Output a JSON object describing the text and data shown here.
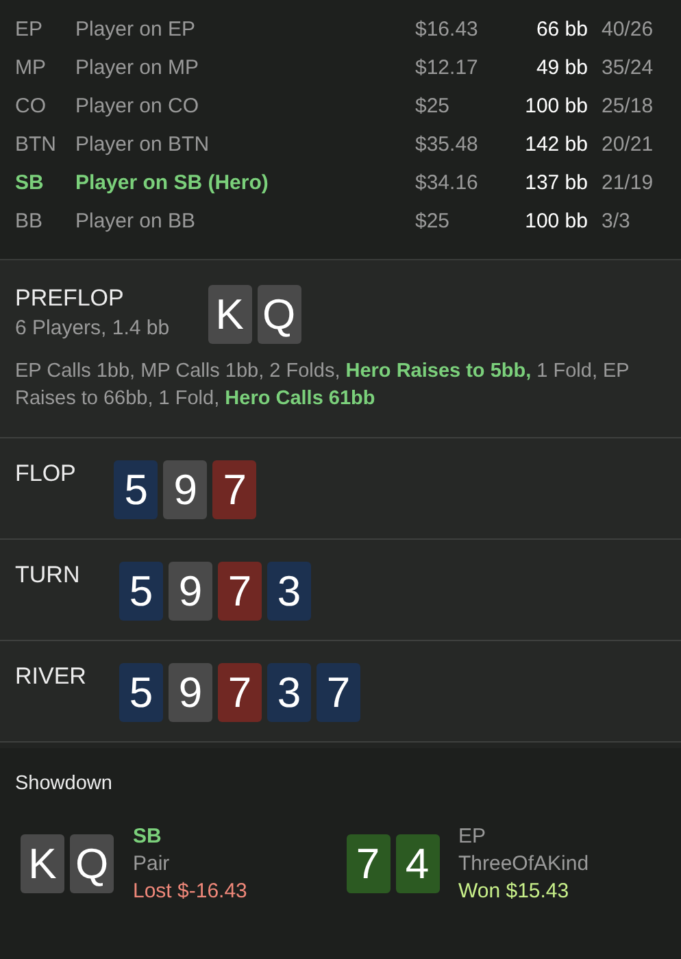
{
  "players": [
    {
      "position": "EP",
      "name": "Player on EP",
      "stack": "$16.43",
      "bb": "66 bb",
      "stats": "40/26",
      "hero": false
    },
    {
      "position": "MP",
      "name": "Player on MP",
      "stack": "$12.17",
      "bb": "49 bb",
      "stats": "35/24",
      "hero": false
    },
    {
      "position": "CO",
      "name": "Player on CO",
      "stack": "$25",
      "bb": "100 bb",
      "stats": "25/18",
      "hero": false
    },
    {
      "position": "BTN",
      "name": "Player on BTN",
      "stack": "$35.48",
      "bb": "142 bb",
      "stats": "20/21",
      "hero": false
    },
    {
      "position": "SB",
      "name": "Player on SB (Hero)",
      "stack": "$34.16",
      "bb": "137 bb",
      "stats": "21/19",
      "hero": true
    },
    {
      "position": "BB",
      "name": "Player on BB",
      "stack": "$25",
      "bb": "100 bb",
      "stats": "3/3",
      "hero": false
    }
  ],
  "streets": [
    {
      "kind": "preflop",
      "name": "PREFLOP",
      "summary": "6 Players, 1.4 bb",
      "cards": [
        {
          "rank": "K",
          "color": "#4a4a4a"
        },
        {
          "rank": "Q",
          "color": "#4a4a4a"
        }
      ],
      "actions": [
        {
          "text": "EP Calls 1bb, MP Calls 1bb, 2 Folds, ",
          "hero": false
        },
        {
          "text": "Hero Raises to 5bb,",
          "hero": true
        },
        {
          "text": " 1 Fold, EP Raises to 66bb, 1 Fold, ",
          "hero": false
        },
        {
          "text": "Hero Calls 61bb",
          "hero": true
        }
      ]
    },
    {
      "kind": "board",
      "name": "FLOP",
      "cards": [
        {
          "rank": "5",
          "color": "#1c3150"
        },
        {
          "rank": "9",
          "color": "#4a4a4a"
        },
        {
          "rank": "7",
          "color": "#712823"
        }
      ]
    },
    {
      "kind": "board",
      "name": "TURN",
      "cards": [
        {
          "rank": "5",
          "color": "#1c3150"
        },
        {
          "rank": "9",
          "color": "#4a4a4a"
        },
        {
          "rank": "7",
          "color": "#712823"
        },
        {
          "rank": "3",
          "color": "#1c3150"
        }
      ]
    },
    {
      "kind": "board",
      "name": "RIVER",
      "cards": [
        {
          "rank": "5",
          "color": "#1c3150"
        },
        {
          "rank": "9",
          "color": "#4a4a4a"
        },
        {
          "rank": "7",
          "color": "#712823"
        },
        {
          "rank": "3",
          "color": "#1c3150"
        },
        {
          "rank": "7",
          "color": "#1c3150"
        }
      ]
    }
  ],
  "showdown": {
    "title": "Showdown",
    "hands": [
      {
        "position": "SB",
        "hero": true,
        "hand": "Pair",
        "result": "Lost $-16.43",
        "won": false,
        "cards": [
          {
            "rank": "K",
            "color": "#4a4a4a"
          },
          {
            "rank": "Q",
            "color": "#4a4a4a"
          }
        ]
      },
      {
        "position": "EP",
        "hero": false,
        "hand": "ThreeOfAKind",
        "result": "Won $15.43",
        "won": true,
        "cards": [
          {
            "rank": "7",
            "color": "#2c5a22"
          },
          {
            "rank": "4",
            "color": "#2c5a22"
          }
        ]
      }
    ]
  }
}
